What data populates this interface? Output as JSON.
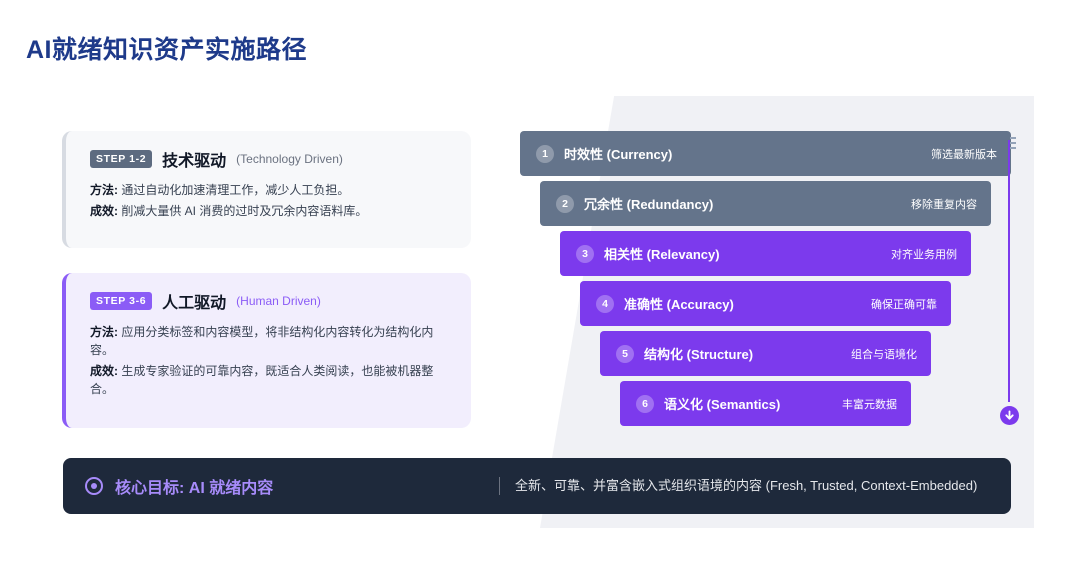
{
  "page": {
    "title": "AI就绪知识资产实施路径"
  },
  "steps": [
    {
      "badge": "STEP 1-2",
      "title": "技术驱动",
      "subtitle": "(Technology Driven)",
      "method_label": "方法:",
      "method_text": "通过自动化加速清理工作，减少人工负担。",
      "result_label": "成效:",
      "result_text": "削减大量供 AI 消费的过时及冗余内容语料库。"
    },
    {
      "badge": "STEP 3-6",
      "title": "人工驱动",
      "subtitle": "(Human Driven)",
      "method_label": "方法:",
      "method_text": "应用分类标签和内容模型，将非结构化内容转化为结构化内容。",
      "result_label": "成效:",
      "result_text": "生成专家验证的可靠内容，既适合人类阅读，也能被机器整合。"
    }
  ],
  "funnel": [
    {
      "num": "1",
      "label": "时效性 (Currency)",
      "note": "筛选最新版本",
      "color": "#64748b"
    },
    {
      "num": "2",
      "label": "冗余性 (Redundancy)",
      "note": "移除重复内容",
      "color": "#64748b"
    },
    {
      "num": "3",
      "label": "相关性 (Relevancy)",
      "note": "对齐业务用例",
      "color": "#7c3aed"
    },
    {
      "num": "4",
      "label": "准确性 (Accuracy)",
      "note": "确保正确可靠",
      "color": "#7c3aed"
    },
    {
      "num": "5",
      "label": "结构化 (Structure)",
      "note": "组合与语境化",
      "color": "#7c3aed"
    },
    {
      "num": "6",
      "label": "语义化 (Semantics)",
      "note": "丰富元数据",
      "color": "#7c3aed"
    }
  ],
  "icons": {
    "goal": "target-icon",
    "flow_end": "arrow-down-circle-icon"
  },
  "goal": {
    "title": "核心目标: AI 就绪内容",
    "description": "全新、可靠、并富含嵌入式组织语境的内容 (Fresh, Trusted, Context-Embedded)"
  }
}
